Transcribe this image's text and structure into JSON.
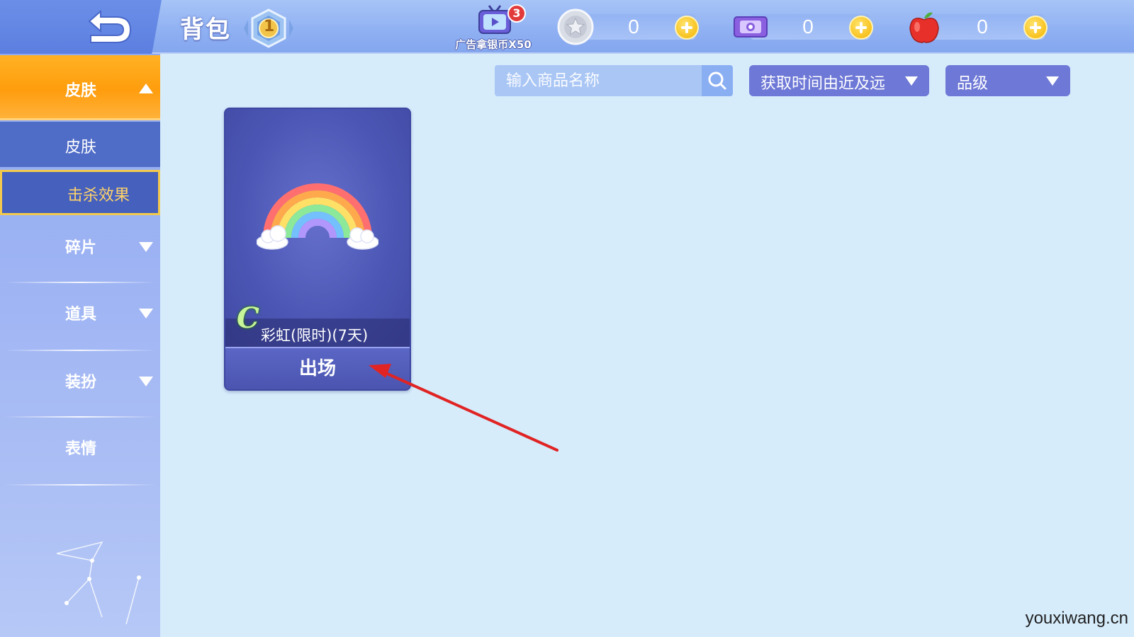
{
  "header": {
    "title": "背包",
    "level": "1",
    "ad": {
      "count": "3",
      "label": "广告拿银币X50"
    },
    "currencies": [
      {
        "name": "silver-coin",
        "value": "0"
      },
      {
        "name": "ticket",
        "value": "0"
      },
      {
        "name": "apple",
        "value": "0"
      }
    ]
  },
  "sidebar": {
    "active": {
      "label": "皮肤"
    },
    "subs": [
      {
        "label": "皮肤"
      },
      {
        "label": "击杀效果"
      }
    ],
    "items": [
      {
        "label": "碎片"
      },
      {
        "label": "道具"
      },
      {
        "label": "装扮"
      },
      {
        "label": "表情"
      }
    ]
  },
  "filters": {
    "search_placeholder": "输入商品名称",
    "sort_label": "获取时间由近及远",
    "grade_label": "品级"
  },
  "card": {
    "grade": "C",
    "name": "彩虹(限时)(7天)",
    "action": "出场"
  },
  "watermark": "youxiwang.cn",
  "colors": {
    "active_tab": "#ff9d0d",
    "selected_border": "#f3c94d",
    "arrow": "#e02424",
    "dropdown": "#6e78d6"
  }
}
